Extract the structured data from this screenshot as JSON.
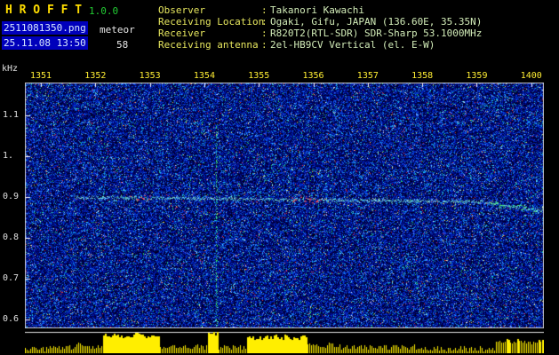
{
  "app": {
    "title": "H R O F F T",
    "version": "1.0.0",
    "filename": "2511081350.png",
    "mode_label": "meteor",
    "datetime": "25.11.08 13:50",
    "count": "58"
  },
  "info": {
    "separator": ":",
    "rows": [
      {
        "label": "Observer",
        "value": "Takanori Kawachi"
      },
      {
        "label": "Receiving Location",
        "value": "Ogaki, Gifu, JAPAN (136.60E, 35.35N)"
      },
      {
        "label": "Receiver",
        "value": "R820T2(RTL-SDR) SDR-Sharp 53.1000MHz"
      },
      {
        "label": "Receiving antenna",
        "value": "2el-HB9CV Vertical (el. E-W)"
      }
    ]
  },
  "spectrogram": {
    "unit_label": "kHz",
    "x_ticks": [
      "1351",
      "1352",
      "1353",
      "1354",
      "1355",
      "1356",
      "1357",
      "1358",
      "1359",
      "1400"
    ],
    "y_ticks": [
      "1.1",
      "1.",
      "0.9",
      "0.8",
      "0.7",
      "0.6"
    ],
    "trace": {
      "frequency_khz": "0.9",
      "start_x": 55,
      "base_y": 128,
      "slope": 0.012,
      "bend_x": 515,
      "bend_slope": 0.14
    },
    "trace_clusters": [
      {
        "from": 118,
        "to": 140,
        "color": "#ff5555"
      },
      {
        "from": 300,
        "to": 338,
        "color": "#ff5555"
      },
      {
        "from": 520,
        "to": 575,
        "color": "#55ff88"
      }
    ],
    "vertical_event_x": 215,
    "amplitude_profile": [
      {
        "from": 0,
        "to": 28,
        "level": 5
      },
      {
        "from": 28,
        "to": 55,
        "level": 6
      },
      {
        "from": 55,
        "to": 70,
        "level": 10
      },
      {
        "from": 70,
        "to": 87,
        "level": 7
      },
      {
        "from": 87,
        "to": 152,
        "level": 20
      },
      {
        "from": 152,
        "to": 205,
        "level": 7
      },
      {
        "from": 205,
        "to": 218,
        "level": 23
      },
      {
        "from": 218,
        "to": 250,
        "level": 6
      },
      {
        "from": 250,
        "to": 318,
        "level": 18
      },
      {
        "from": 318,
        "to": 355,
        "level": 9
      },
      {
        "from": 355,
        "to": 445,
        "level": 7
      },
      {
        "from": 445,
        "to": 530,
        "level": 5
      },
      {
        "from": 530,
        "to": 584,
        "level": 13
      }
    ],
    "colors": {
      "plot_background": "#000022",
      "noise_blue": "#2244ee",
      "trace_cyan": "#66ffdd",
      "echo_red": "#ff4444",
      "event_green": "#44ee77",
      "amplitude_yellow": "#ffee00",
      "frame": "#c8c8c8"
    }
  }
}
